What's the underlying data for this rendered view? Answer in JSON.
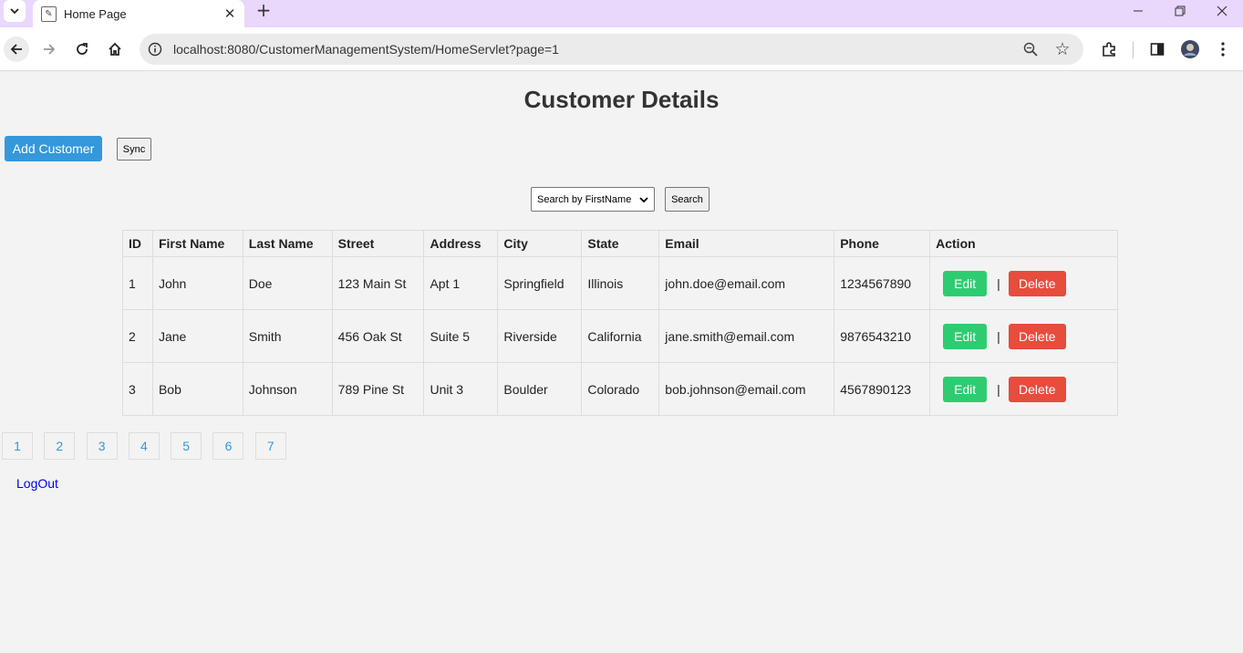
{
  "browser": {
    "tab_title": "Home Page",
    "url": "localhost:8080/CustomerManagementSystem/HomeServlet?page=1",
    "icons": [
      "tab-search-icon",
      "favicon-icon",
      "close-icon",
      "new-tab-icon",
      "minimize-icon",
      "restore-icon",
      "window-close-icon",
      "back-icon",
      "forward-icon",
      "reload-icon",
      "home-icon",
      "site-info-icon",
      "zoom-icon",
      "bookmark-star-icon",
      "extensions-icon",
      "side-panel-icon",
      "profile-avatar",
      "more-menu-icon"
    ]
  },
  "page": {
    "title": "Customer Details",
    "add_label": "Add Customer",
    "sync_label": "Sync",
    "search_select": "Search by FirstName",
    "search_label": "Search",
    "logout_label": "LogOut"
  },
  "table": {
    "headers": [
      "ID",
      "First Name",
      "Last Name",
      "Street",
      "Address",
      "City",
      "State",
      "Email",
      "Phone",
      "Action"
    ],
    "rows": [
      {
        "id": "1",
        "first": "John",
        "last": "Doe",
        "street": "123 Main St",
        "address": "Apt 1",
        "city": "Springfield",
        "state": "Illinois",
        "email": "john.doe@email.com",
        "phone": "1234567890"
      },
      {
        "id": "2",
        "first": "Jane",
        "last": "Smith",
        "street": "456 Oak St",
        "address": "Suite 5",
        "city": "Riverside",
        "state": "California",
        "email": "jane.smith@email.com",
        "phone": "9876543210"
      },
      {
        "id": "3",
        "first": "Bob",
        "last": "Johnson",
        "street": "789 Pine St",
        "address": "Unit 3",
        "city": "Boulder",
        "state": "Colorado",
        "email": "bob.johnson@email.com",
        "phone": "4567890123"
      }
    ],
    "edit_label": "Edit",
    "separator": "|",
    "delete_label": "Delete"
  },
  "pagination": [
    "1",
    "2",
    "3",
    "4",
    "5",
    "6",
    "7"
  ],
  "colors": {
    "tabstrip": "#e9d8fb",
    "add": "#3498db",
    "edit": "#2ecc71",
    "delete": "#e74c3c",
    "link": "#0000ee"
  }
}
